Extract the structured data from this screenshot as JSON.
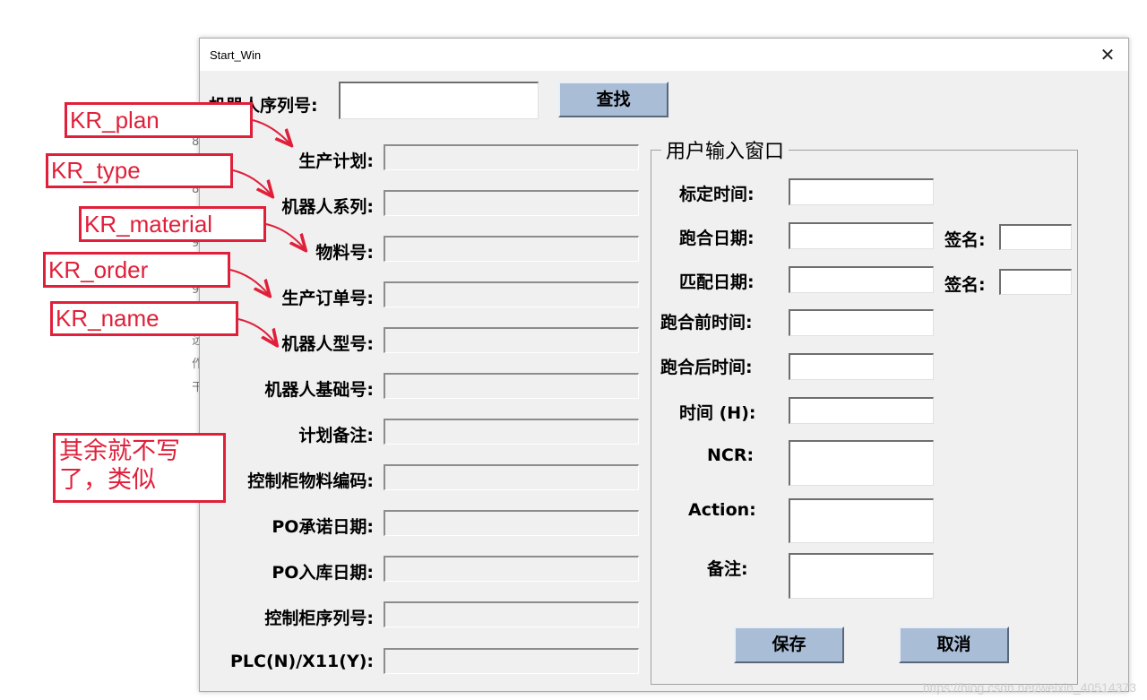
{
  "window": {
    "title": "Start_Win",
    "close_glyph": "✕"
  },
  "search": {
    "label": "机器人序列号:",
    "button_label": "查找"
  },
  "info_fields": [
    {
      "label": "生产计划:"
    },
    {
      "label": "机器人系列:"
    },
    {
      "label": "物料号:"
    },
    {
      "label": "生产订单号:"
    },
    {
      "label": "机器人型号:"
    },
    {
      "label": "机器人基础号:"
    },
    {
      "label": "计划备注:"
    },
    {
      "label": "控制柜物料编码:"
    },
    {
      "label": "PO承诺日期:"
    },
    {
      "label": "PO入库日期:"
    },
    {
      "label": "控制柜序列号:"
    },
    {
      "label": "PLC(N)/X11(Y):"
    }
  ],
  "user_group": {
    "title": "用户输入窗口",
    "fields": [
      {
        "label": "标定时间:"
      },
      {
        "label": "跑合日期:",
        "sign_label": "签名:"
      },
      {
        "label": "匹配日期:",
        "sign_label": "签名:"
      },
      {
        "label": "跑合前时间:"
      },
      {
        "label": "跑合后时间:"
      },
      {
        "label": "时间 (H):"
      },
      {
        "label": "NCR:"
      },
      {
        "label": "Action:"
      },
      {
        "label": "备注:"
      }
    ],
    "save_label": "保存",
    "cancel_label": "取消"
  },
  "annotations": {
    "plan": "KR_plan",
    "type": "KR_type",
    "material": "KR_material",
    "order": "KR_order",
    "name": "KR_name",
    "note": "其余就不写了，类似"
  },
  "background_fragments": [
    "8",
    "8",
    "9",
    "9",
    "远",
    "作",
    "干"
  ],
  "watermark": "https://blog.csdn.net/weixin_40514373",
  "colors": {
    "annotation_red": "#e0203a",
    "button_blue": "#a9bdd7",
    "window_bg": "#f0f0f0"
  }
}
